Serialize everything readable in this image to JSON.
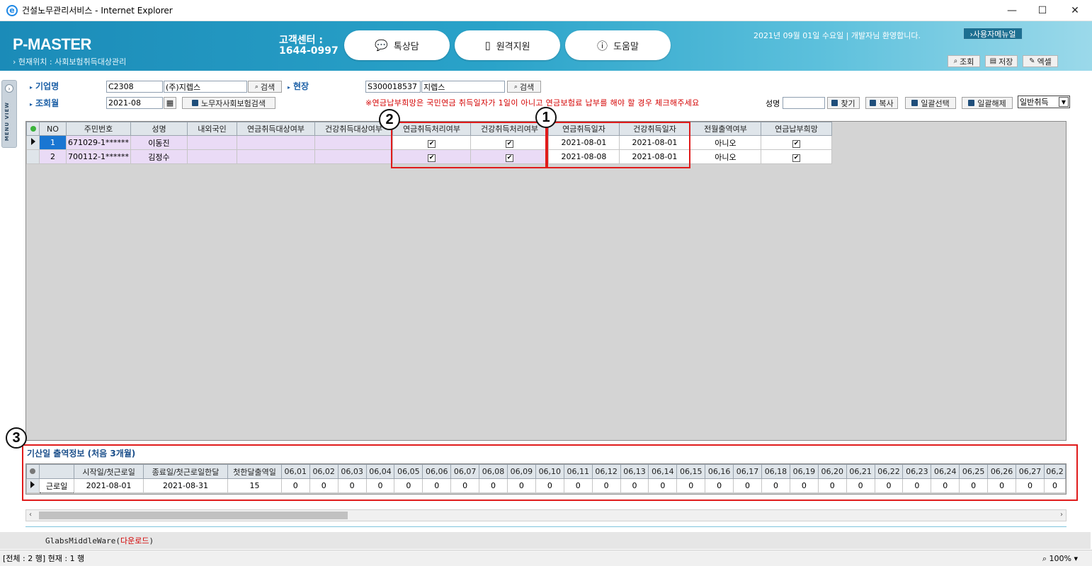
{
  "window": {
    "title": "건설노무관리서비스 - Internet Explorer",
    "minimize": "—",
    "maximize": "☐",
    "close": "✕"
  },
  "header": {
    "logo": "P-MASTER",
    "location": "› 현재위치 : 사회보험취득대상관리",
    "cs_label": "고객센터 :",
    "cs_phone": "1644-0997",
    "btn_chat": "톡상담",
    "btn_remote": "원격지원",
    "btn_help": "도움말",
    "date_line": "2021년 09월 01일 수요일 | 개발자님 환영합니다.",
    "user_menu": "›사용자메뉴얼",
    "btn_search": "조회",
    "btn_save": "저장",
    "btn_excel": "엑셀"
  },
  "menu_tab": {
    "text": "MENU VIEW"
  },
  "filters": {
    "company_label": "기업명",
    "company_code": "C2308",
    "company_name": "(주)지렙스",
    "search_label": "검색",
    "site_label": "현장",
    "site_code": "S300018537",
    "site_name": "지렙스",
    "month_label": "조회월",
    "month_value": "2021-08",
    "worker_search": "노무자사회보험검색",
    "notice": "※연금납부희망은 국민연금 취득일자가 1일이 아니고 연금보험료 납부를 해야 할 경우 체크해주세요",
    "name_label": "성명",
    "name_value": "",
    "btn_find": "찾기",
    "btn_copy": "복사",
    "btn_select_all": "일괄선택",
    "btn_deselect_all": "일괄해제",
    "select_value": "일반취득"
  },
  "main_grid": {
    "columns": [
      "NO",
      "주민번호",
      "성명",
      "내외국인",
      "연금취득대상여부",
      "건강취득대상여부",
      "연금취득처리여부",
      "건강취득처리여부",
      "연금취득일자",
      "건강취득일자",
      "전월출역여부",
      "연금납부희망"
    ],
    "rows": [
      {
        "no": "1",
        "rrn": "671029-1******",
        "name": "이동진",
        "foreign": "",
        "pension_target": "",
        "health_target": "",
        "pension_done": "✔",
        "health_done": "✔",
        "pension_date": "2021-08-01",
        "health_date": "2021-08-01",
        "prev_month": "아니오",
        "pension_pay": "✔"
      },
      {
        "no": "2",
        "rrn": "700112-1******",
        "name": "김정수",
        "foreign": "",
        "pension_target": "",
        "health_target": "",
        "pension_done": "✔",
        "health_done": "✔",
        "pension_date": "2021-08-08",
        "health_date": "2021-08-01",
        "prev_month": "아니오",
        "pension_pay": "✔"
      }
    ]
  },
  "annotations": {
    "one": "1",
    "two": "2",
    "three": "3"
  },
  "sub_section": {
    "title": "기산일 출역정보 (처음 3개월)",
    "columns": [
      "",
      "시작일/첫근로일",
      "종료일/첫근로일한달",
      "첫한달출역일",
      "06,01",
      "06,02",
      "06,03",
      "06,04",
      "06,05",
      "06,06",
      "06,07",
      "06,08",
      "06,09",
      "06,10",
      "06,11",
      "06,12",
      "06,13",
      "06,14",
      "06,15",
      "06,16",
      "06,17",
      "06,18",
      "06,19",
      "06,20",
      "06,21",
      "06,22",
      "06,23",
      "06,24",
      "06,25",
      "06,26",
      "06,27",
      "06,2"
    ],
    "row": [
      "근로일",
      "2021-08-01",
      "2021-08-31",
      "15",
      "0",
      "0",
      "0",
      "0",
      "0",
      "0",
      "0",
      "0",
      "0",
      "0",
      "0",
      "0",
      "0",
      "0",
      "0",
      "0",
      "0",
      "0",
      "0",
      "0",
      "0",
      "0",
      "0",
      "0",
      "0",
      "0",
      "0",
      "0"
    ]
  },
  "middleware": {
    "text": "GlabsMiddleWare(",
    "link": "다운로드",
    "close": ")"
  },
  "status": {
    "text": "[전체 : 2 행] 현재 : 1 행",
    "zoom": "100%"
  },
  "colors": {
    "banner": "#1b8bb8",
    "accent": "#1b5fa6",
    "notice": "#d40000",
    "selected_row_bg": "#eadbf6",
    "annotation": "#e01b1b"
  }
}
